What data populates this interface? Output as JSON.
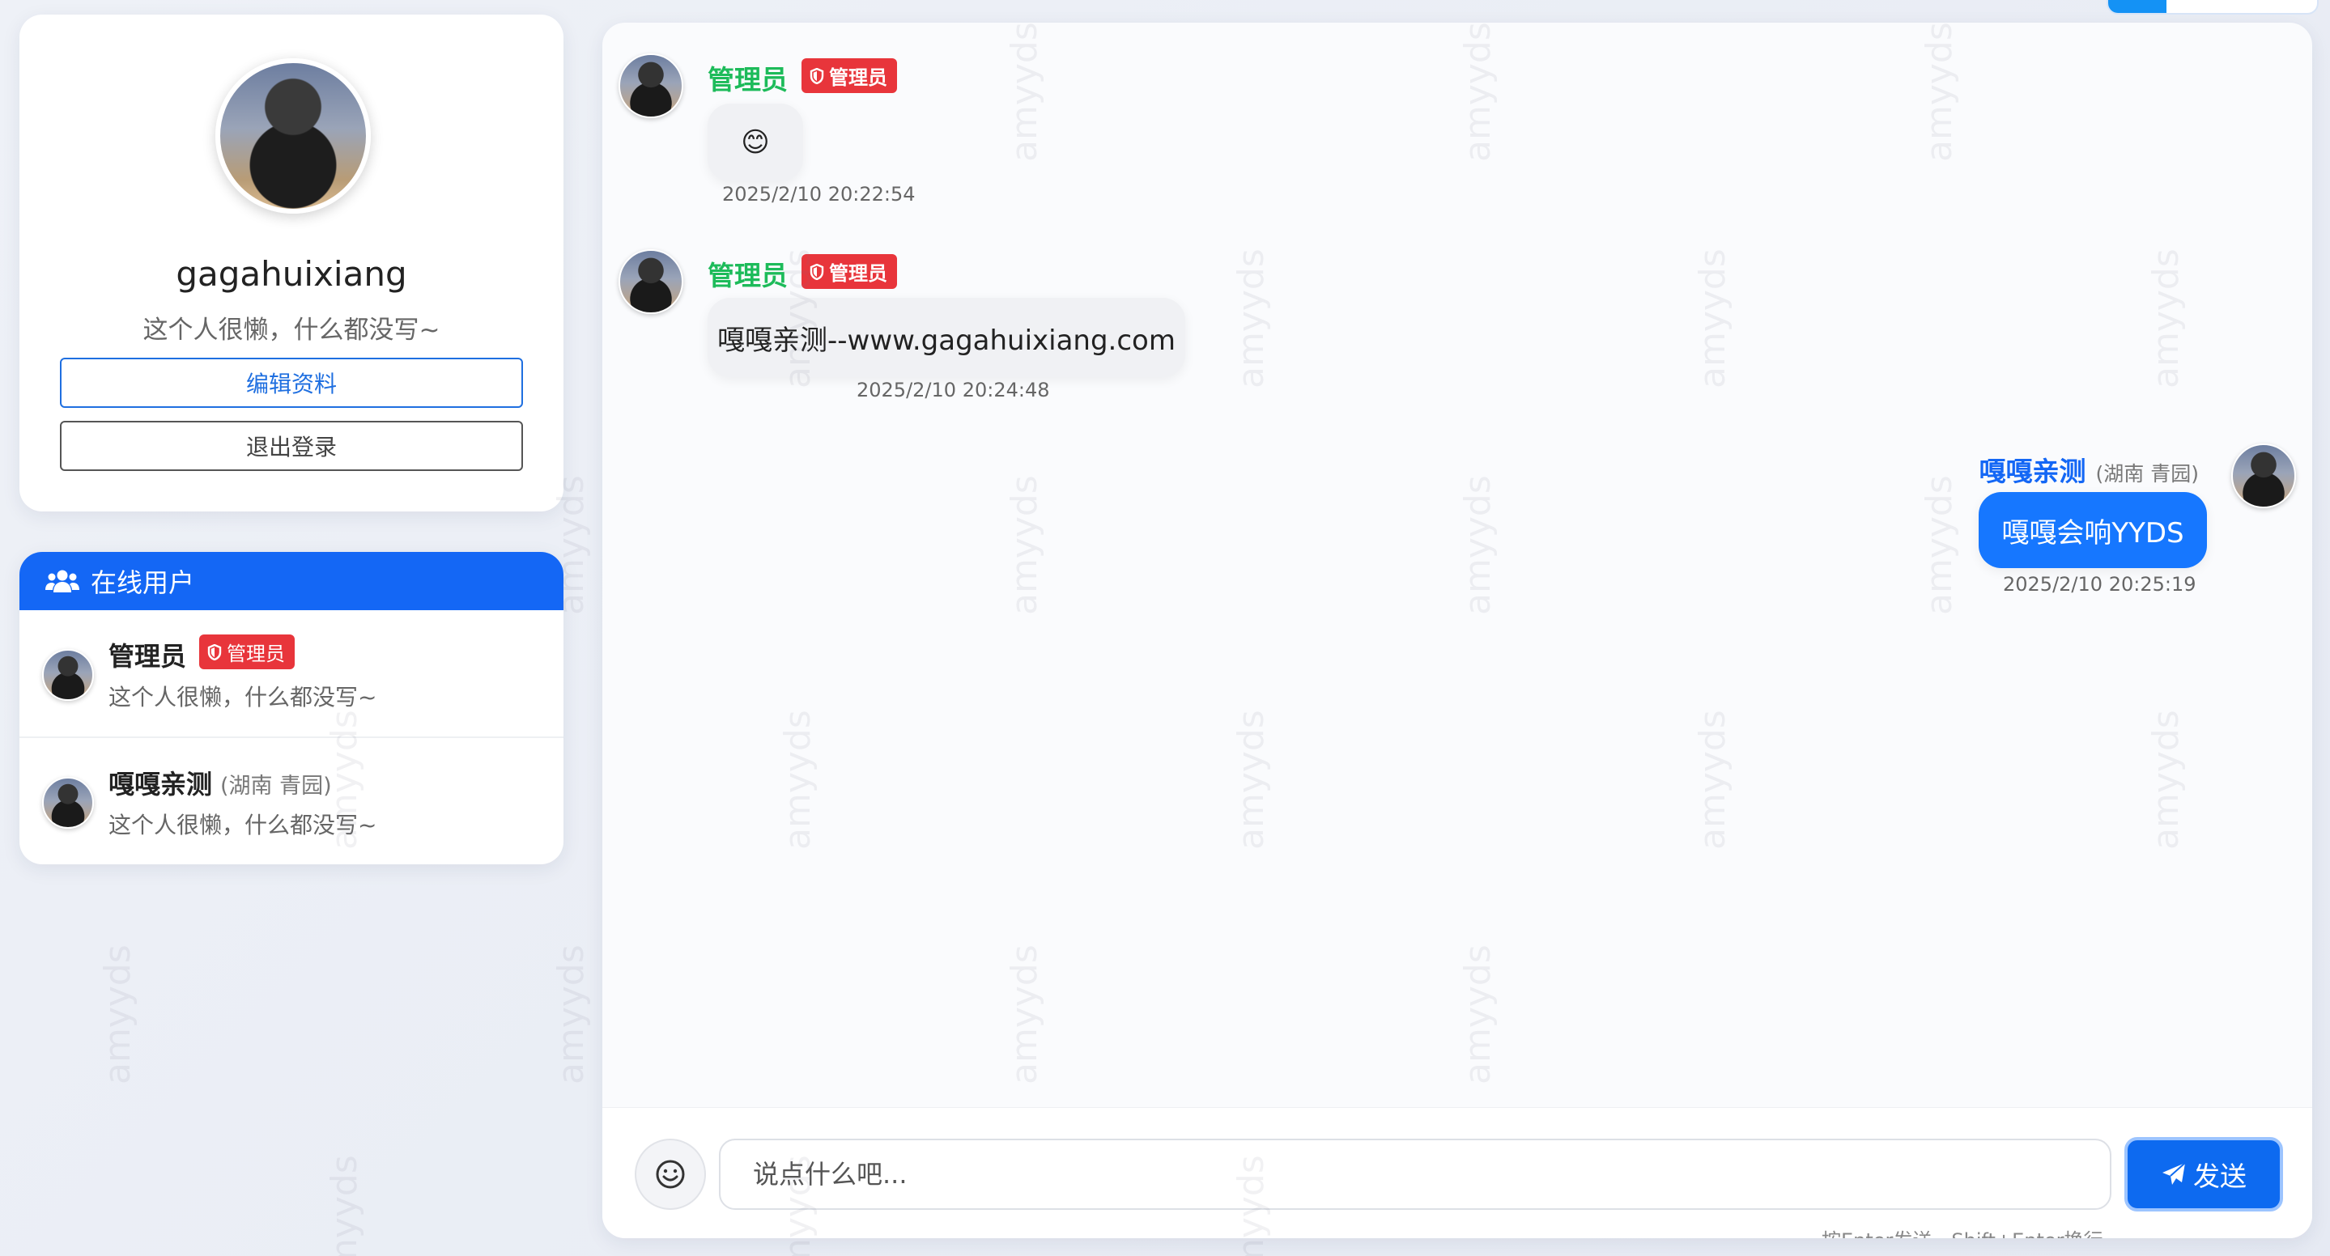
{
  "profile": {
    "username": "gagahuixiang",
    "signature": "这个人很懒，什么都没写~",
    "edit_button": "编辑资料",
    "logout_button": "退出登录"
  },
  "online_users": {
    "title": "在线用户",
    "users": [
      {
        "name": "管理员",
        "badge": "管理员",
        "location": "",
        "signature": "这个人很懒，什么都没写~"
      },
      {
        "name": "嘎嘎亲测",
        "badge": "",
        "location": "(湖南 青园)",
        "signature": "这个人很懒，什么都没写~"
      }
    ]
  },
  "messages": [
    {
      "sender": "管理员",
      "badge": "管理员",
      "content": "😊",
      "time": "2025/2/10 20:22:54",
      "side": "left"
    },
    {
      "sender": "管理员",
      "badge": "管理员",
      "content": "嘎嘎亲测--www.gagahuixiang.com",
      "time": "2025/2/10 20:24:48",
      "side": "left"
    },
    {
      "sender": "嘎嘎亲测",
      "location": "(湖南 青园)",
      "content": "嘎嘎会响YYDS",
      "time": "2025/2/10 20:25:19",
      "side": "right"
    }
  ],
  "composer": {
    "placeholder": "说点什么吧...",
    "send_label": "发送",
    "hint": "按Enter发送，Shift+Enter换行"
  },
  "watermark": "amyyds",
  "icons": {
    "users": "users-icon",
    "shield": "shield-icon",
    "emoji": "smile-icon",
    "send": "paper-plane-icon"
  },
  "colors": {
    "primary": "#1467f5",
    "admin_name": "#1dbb5a",
    "admin_badge": "#e8353b",
    "my_bubble": "#1677ff"
  }
}
